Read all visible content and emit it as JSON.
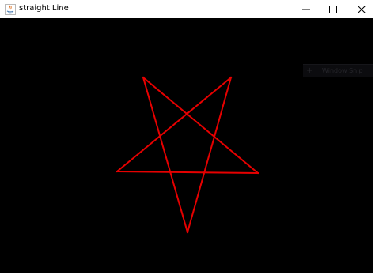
{
  "window": {
    "title": "straight Line"
  },
  "controls": {
    "minimize": "minimize",
    "maximize": "maximize",
    "close": "close"
  },
  "overlay": {
    "plus": "+",
    "label": "Window Snip"
  },
  "canvas": {
    "background": "#000000",
    "stroke_color": "#e60000",
    "shape": "pentagram"
  },
  "colors": {
    "titlebar": "#ffffff",
    "title_text": "#000000"
  }
}
